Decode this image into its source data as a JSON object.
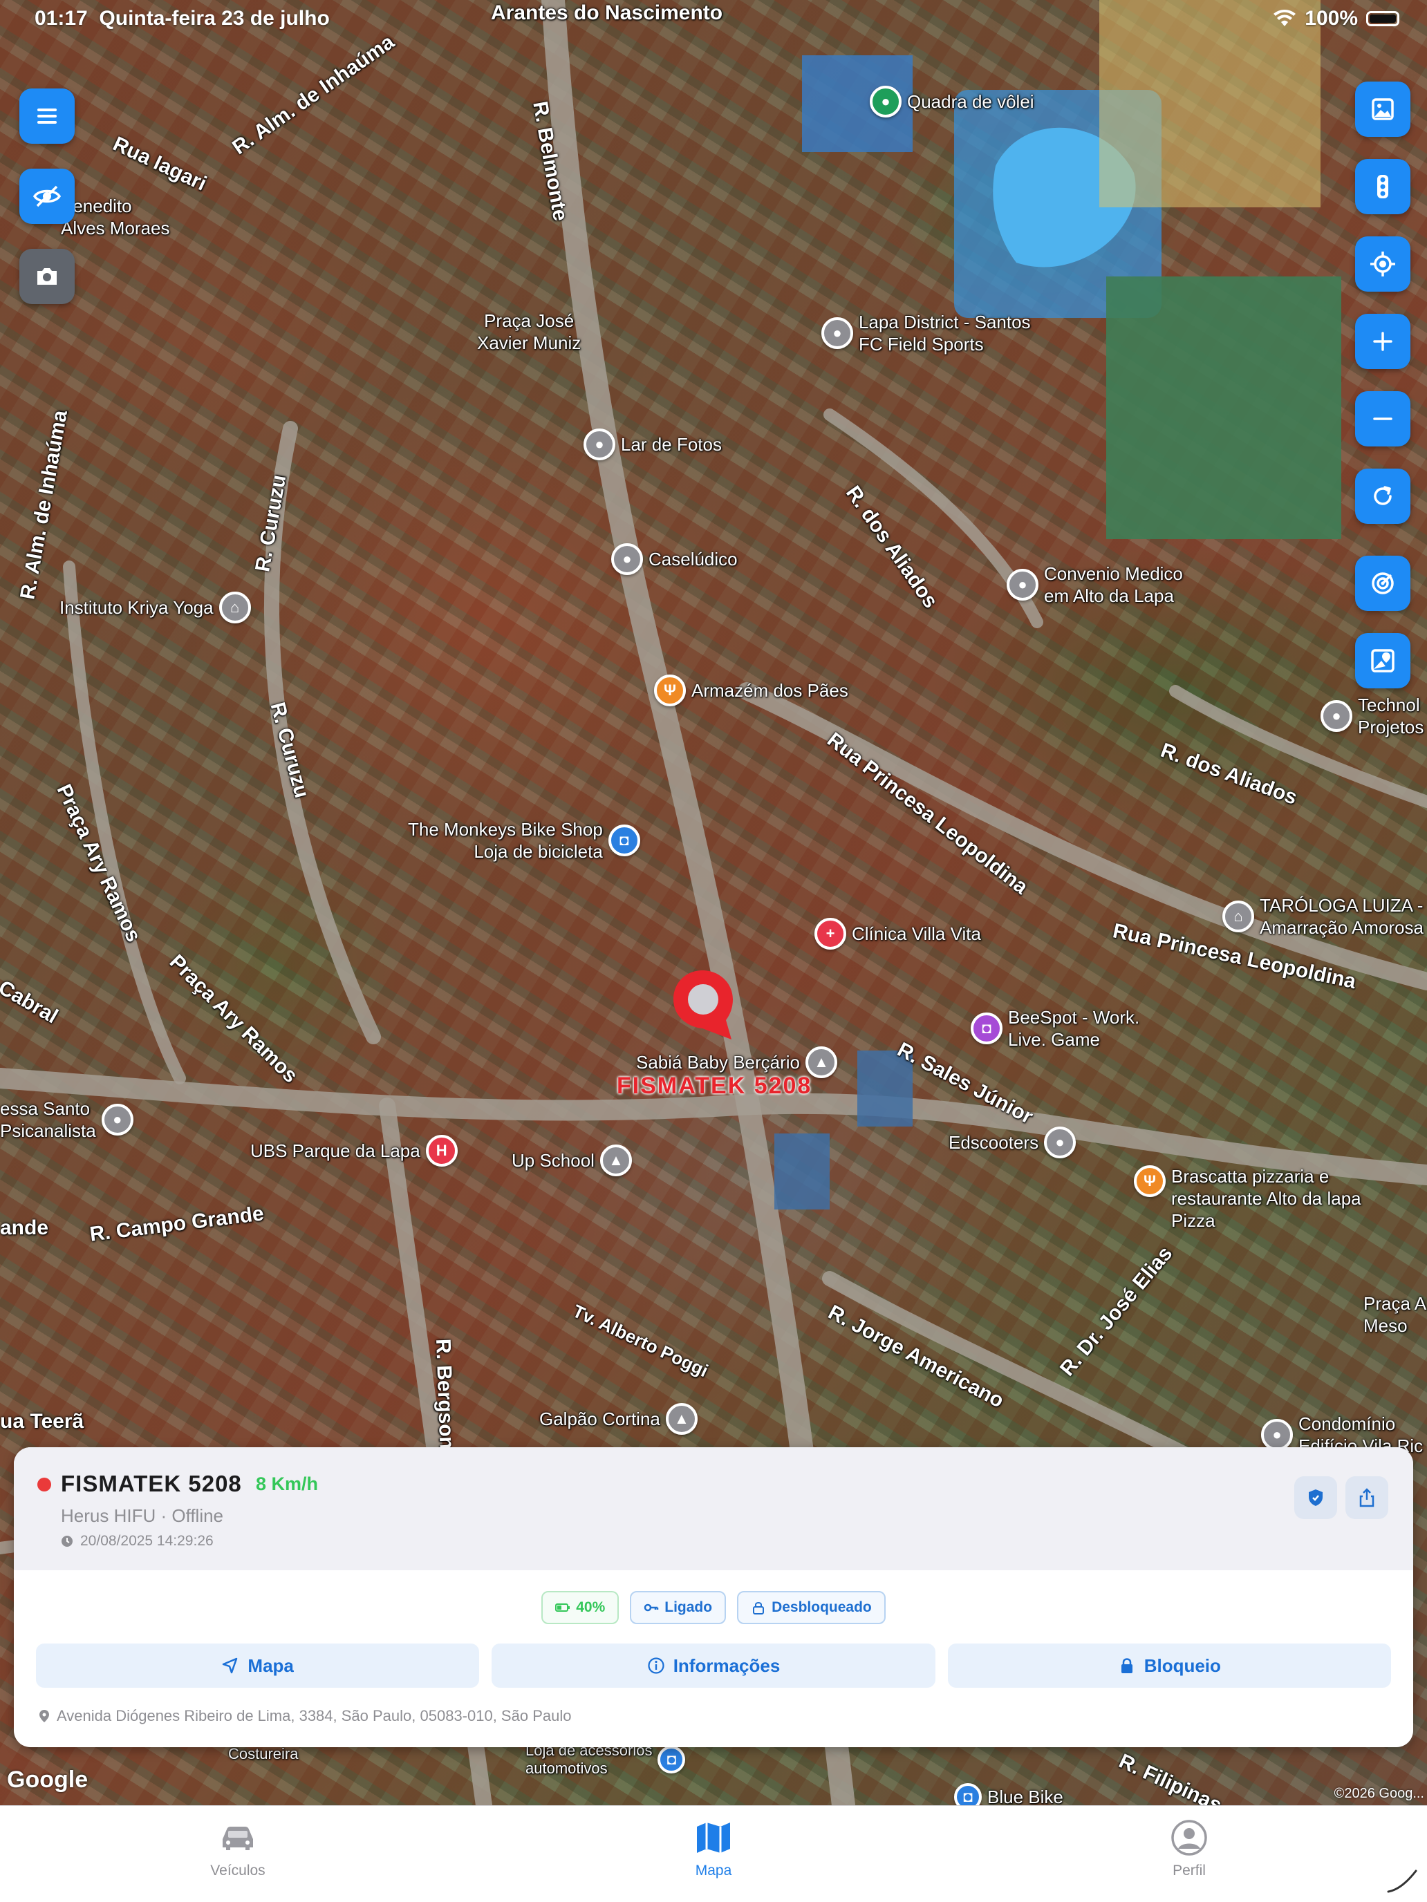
{
  "status_bar": {
    "time": "01:17",
    "date": "Quinta-feira 23 de julho",
    "battery": "100%"
  },
  "map": {
    "provider": "Google",
    "copyright": "©2026 Goog...",
    "street_labels": [
      "Arantes do Nascimento",
      "R. Alm. de Inhaúma",
      "Rua Iagari",
      "R. Belmonte",
      "Benedito\nAlves Moraes",
      "Praça José\nXavier Muniz",
      "R. Alm. de Inhaúma",
      "R. Curuzu",
      "R. Curuzu",
      "Praça Ary Ramos",
      "Praça Ary Ramos",
      "R. dos Aliados",
      "R. dos Aliados",
      "Rua Princesa Leopoldina",
      "Rua Princesa Leopoldina",
      "R. Sales Júnior",
      "R. Campo Grande",
      "Tv. Alberto Poggi",
      "R. Jorge Americano",
      "R. Dr. José Elias",
      "R. Bergson",
      "ua Teerã",
      "Cabral",
      "ande",
      "R. Filipinas",
      "Praça A\nMeso"
    ],
    "pois": [
      {
        "name": "Quadra de vôlei",
        "icon": "pin-icon"
      },
      {
        "name": "Lapa District - Santos\nFC Field Sports",
        "icon": "pin-icon"
      },
      {
        "name": "Lar de Fotos",
        "icon": "pin-icon"
      },
      {
        "name": "Caselúdico",
        "icon": "pin-icon"
      },
      {
        "name": "Convenio Medico\nem Alto da Lapa",
        "icon": "pin-icon"
      },
      {
        "name": "Instituto Kriya Yoga",
        "icon": "temple-icon"
      },
      {
        "name": "Armazém dos Pães",
        "icon": "fork-knife-icon"
      },
      {
        "name": "Technol\nProjetos",
        "icon": "pin-icon"
      },
      {
        "name": "The Monkeys Bike Shop\nLoja de bicicleta",
        "icon": "bag-icon"
      },
      {
        "name": "Clínica Villa Vita",
        "icon": "hospital-icon"
      },
      {
        "name": "TARÓLOGA LUIZA -\nAmarração Amorosa",
        "icon": "temple-icon"
      },
      {
        "name": "BeeSpot - Work.\nLive. Game",
        "icon": "bag-icon"
      },
      {
        "name": "Sabiá Baby Berçário",
        "icon": "school-icon"
      },
      {
        "name": "essa Santo\nPsicanalista",
        "icon": "pin-icon"
      },
      {
        "name": "UBS Parque da Lapa",
        "icon": "hospital-icon"
      },
      {
        "name": "Up School",
        "icon": "school-icon"
      },
      {
        "name": "Edscooters",
        "icon": "pin-icon"
      },
      {
        "name": "Brascatta pizzaria e\nrestaurante Alto da lapa\nPizza",
        "icon": "fork-knife-icon"
      },
      {
        "name": "Galpão Cortina",
        "icon": "school-icon"
      },
      {
        "name": "Condomínio\nEdifício Vila Ric",
        "icon": "pin-icon"
      },
      {
        "name": "Costureira",
        "icon": "pin-icon"
      },
      {
        "name": "Loja de acessórios\nautomotivos",
        "icon": "bag-icon"
      },
      {
        "name": "Blue Bike",
        "icon": "bag-icon"
      }
    ],
    "vehicle_marker_label": "FISMATEK 5208"
  },
  "left_controls": [
    "menu-icon",
    "eye-off-icon",
    "camera-icon"
  ],
  "right_controls": [
    "map-layer-icon",
    "traffic-light-icon",
    "locate-icon",
    "zoom-in-icon",
    "zoom-out-icon",
    "refresh-icon",
    "radar-icon",
    "map-pin-person-icon"
  ],
  "vehicle_card": {
    "name": "FISMATEK 5208",
    "speed": "8 Km/h",
    "subtitle": "Herus HIFU · Offline",
    "timestamp": "20/08/2025 14:29:26",
    "status_color": "#EA3A3A",
    "chips": {
      "battery": "40%",
      "ignition": "Ligado",
      "lock_state": "Desbloqueado"
    },
    "actions": {
      "map": "Mapa",
      "info": "Informações",
      "block": "Bloqueio"
    },
    "address": "Avenida Diógenes Ribeiro de Lima, 3384, São Paulo, 05083-010, São Paulo"
  },
  "tabbar": {
    "vehicles": "Veículos",
    "map": "Mapa",
    "profile": "Perfil",
    "active": "map"
  },
  "colors": {
    "accent": "#1E8BF5",
    "speed": "#34C759",
    "alert": "#EA3A3A"
  }
}
